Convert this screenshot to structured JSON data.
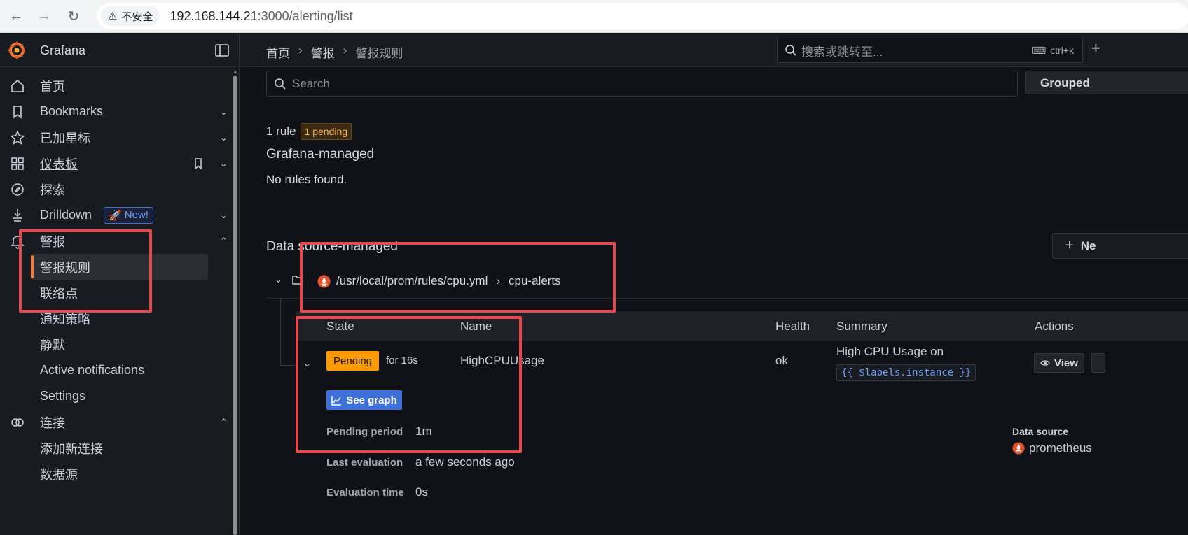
{
  "browser": {
    "insecure_label": "不安全",
    "url_host": "192.168.144.21",
    "url_path": ":3000/alerting/list"
  },
  "brand": {
    "name": "Grafana"
  },
  "sidebar": {
    "items": [
      {
        "label": "首页",
        "icon": "home-icon"
      },
      {
        "label": "Bookmarks",
        "icon": "bookmark-icon"
      },
      {
        "label": "已加星标",
        "icon": "star-icon"
      },
      {
        "label": "仪表板",
        "icon": "apps-icon"
      },
      {
        "label": "探索",
        "icon": "compass-icon"
      },
      {
        "label": "Drilldown",
        "icon": "drilldown-icon",
        "badge": "New!"
      },
      {
        "label": "警报",
        "icon": "bell-icon"
      },
      {
        "label": "连接",
        "icon": "link-icon"
      }
    ],
    "alert_children": [
      "警报规则",
      "联络点",
      "通知策略",
      "静默",
      "Active notifications",
      "Settings"
    ],
    "conn_children": [
      "添加新连接",
      "数据源"
    ]
  },
  "topbar": {
    "crumbs": [
      "首页",
      "警报",
      "警报规则"
    ],
    "search_placeholder": "搜索或跳转至...",
    "shortcut": "ctrl+k"
  },
  "main": {
    "search_placeholder": "Search",
    "view_mode": "Grouped",
    "rule_count": "1 rule",
    "pending_count": "1 pending",
    "grafana_title": "Grafana-managed",
    "no_rules": "No rules found.",
    "ds_title": "Data source-managed",
    "new_rule_label": "Ne",
    "namespace_path": "/usr/local/prom/rules/cpu.yml",
    "group_name": "cpu-alerts",
    "columns": [
      "State",
      "Name",
      "Health",
      "Summary",
      "Actions"
    ],
    "rule": {
      "state": "Pending",
      "for": "for 16s",
      "name": "HighCPUUsage",
      "health": "ok",
      "summary": "High CPU Usage on",
      "summary_code": "{{ $labels.instance }}",
      "view": "View",
      "see_graph": "See graph",
      "pending_period_label": "Pending period",
      "pending_period": "1m",
      "last_eval_label": "Last evaluation",
      "last_eval": "a few seconds ago",
      "eval_time_label": "Evaluation time",
      "eval_time": "0s",
      "datasource_label": "Data source",
      "datasource": "prometheus"
    }
  },
  "colors": {
    "accent": "#f47a37",
    "pending": "#ff9900",
    "primary": "#3d71d9",
    "annotation": "#e5484d"
  }
}
